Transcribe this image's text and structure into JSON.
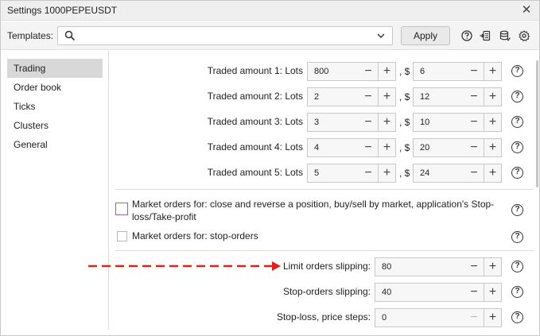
{
  "window": {
    "title": "Settings 1000PEPEUSDT"
  },
  "toolbar": {
    "templates_label": "Templates:",
    "template_value": "",
    "apply_label": "Apply"
  },
  "sidebar": {
    "items": [
      {
        "label": "Trading",
        "active": true
      },
      {
        "label": "Order book"
      },
      {
        "label": "Ticks"
      },
      {
        "label": "Clusters"
      },
      {
        "label": "General"
      }
    ]
  },
  "traded": [
    {
      "label": "Traded amount 1: Lots",
      "lots": "800",
      "usd": "6"
    },
    {
      "label": "Traded amount 2: Lots",
      "lots": "2",
      "usd": "12"
    },
    {
      "label": "Traded amount 3: Lots",
      "lots": "3",
      "usd": "10"
    },
    {
      "label": "Traded amount 4: Lots",
      "lots": "4",
      "usd": "20"
    },
    {
      "label": "Traded amount 5: Lots",
      "lots": "5",
      "usd": "24"
    }
  ],
  "currency_sep": ", $",
  "market_orders": {
    "close_reverse_label": "Market orders for: close and reverse a position, buy/sell by market, application's Stop-loss/Take-profit",
    "stop_orders_label": "Market orders for: stop-orders"
  },
  "slipping": [
    {
      "label": "Limit orders slipping:",
      "value": "80"
    },
    {
      "label": "Stop-orders slipping:",
      "value": "40"
    },
    {
      "label": "Stop-loss, price steps:",
      "value": "0"
    }
  ],
  "annotation": {
    "arrow_color": "#e0201b"
  },
  "help_glyph": "?",
  "plus_glyph": "+",
  "minus_glyph": "−",
  "close_glyph": "✕"
}
